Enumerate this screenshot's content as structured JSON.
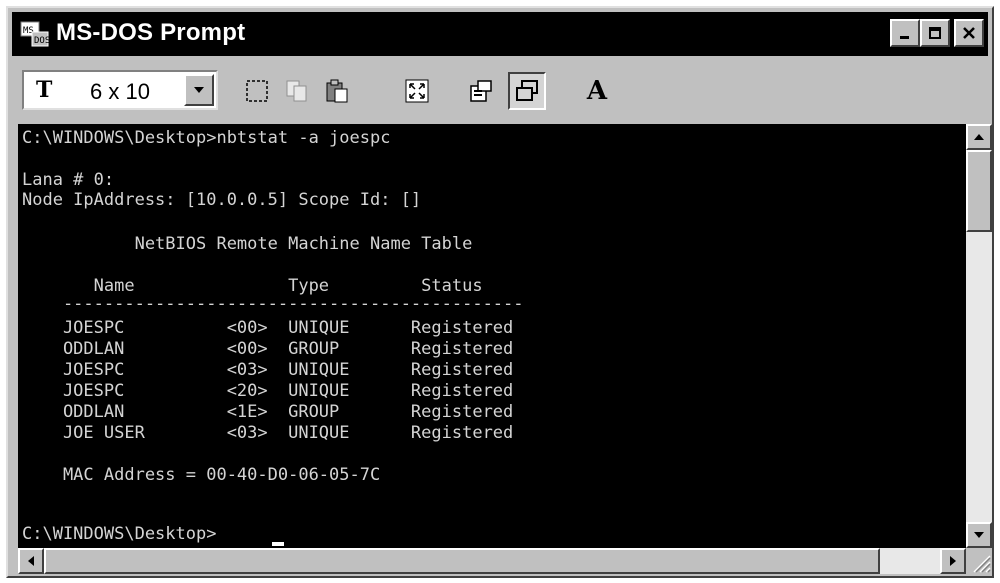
{
  "window": {
    "title": "MS-DOS Prompt",
    "title_icon": "ms-dos-icon",
    "controls": [
      "minimize-icon",
      "restore-icon",
      "close-icon"
    ]
  },
  "toolbar": {
    "font_glyph": "T",
    "font_size": "6 x 10",
    "font_style_label": "A",
    "tools": [
      "mark-icon",
      "copy-icon",
      "paste-icon",
      "fullscreen-icon",
      "properties-icon",
      "background-icon",
      "font-icon"
    ]
  },
  "console": {
    "lines": [
      "C:\\WINDOWS\\Desktop>nbtstat -a joespc",
      "",
      "Lana # 0:",
      "Node IpAddress: [10.0.0.5] Scope Id: []",
      "",
      "           NetBIOS Remote Machine Name Table",
      "",
      "       Name               Type         Status",
      "    ---------------------------------------------",
      "    JOESPC          <00>  UNIQUE      Registered",
      "    ODDLAN          <00>  GROUP       Registered",
      "    JOESPC          <03>  UNIQUE      Registered",
      "    JOESPC          <20>  UNIQUE      Registered",
      "    ODDLAN          <1E>  GROUP       Registered",
      "    JOE USER        <03>  UNIQUE      Registered",
      "",
      "    MAC Address = 00-40-D0-06-05-7C",
      "",
      "",
      "C:\\WINDOWS\\Desktop>"
    ]
  },
  "colors": {
    "titlebar": "#000000",
    "console_bg": "#000000",
    "console_text": "#d4d4d4",
    "chrome": "#c0c0c0"
  }
}
